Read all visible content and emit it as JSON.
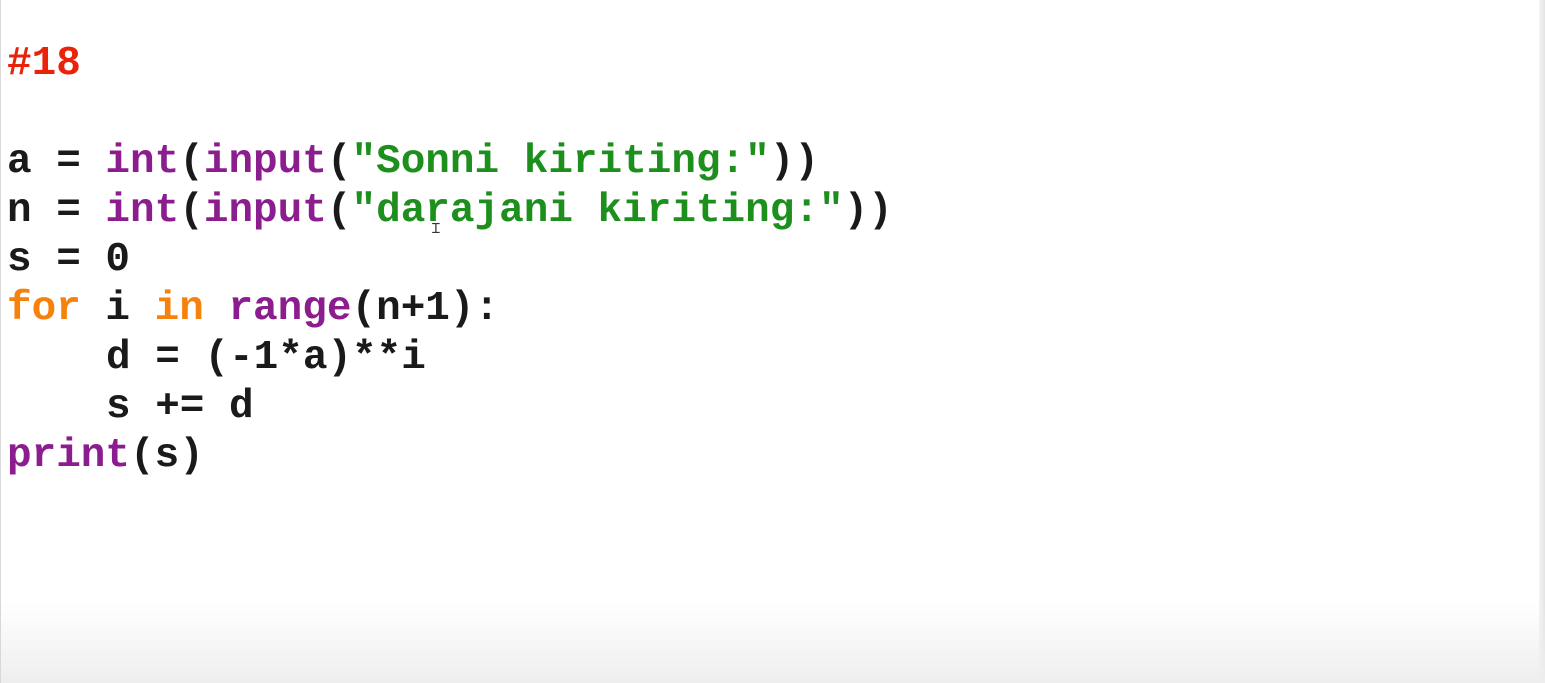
{
  "colors": {
    "comment": "#e8230a",
    "builtin": "#8b1d8e",
    "keyword": "#f5820d",
    "string": "#1d8f1d",
    "default": "#1a1a1a"
  },
  "lines": [
    {
      "name": "comment-line",
      "indent": false,
      "tokens": [
        {
          "t": "#18",
          "c": "comment"
        }
      ]
    },
    {
      "name": "blank-line",
      "indent": false,
      "tokens": []
    },
    {
      "name": "code-line-a",
      "indent": false,
      "tokens": [
        {
          "t": "a = ",
          "c": "default"
        },
        {
          "t": "int",
          "c": "builtin"
        },
        {
          "t": "(",
          "c": "default"
        },
        {
          "t": "input",
          "c": "builtin"
        },
        {
          "t": "(",
          "c": "default"
        },
        {
          "t": "\"Sonni kiriting:\"",
          "c": "string"
        },
        {
          "t": "))",
          "c": "default"
        }
      ]
    },
    {
      "name": "code-line-n",
      "indent": false,
      "tokens": [
        {
          "t": "n = ",
          "c": "default"
        },
        {
          "t": "int",
          "c": "builtin"
        },
        {
          "t": "(",
          "c": "default"
        },
        {
          "t": "input",
          "c": "builtin"
        },
        {
          "t": "(",
          "c": "default"
        },
        {
          "t": "\"darajani kiriting:\"",
          "c": "string"
        },
        {
          "t": "))",
          "c": "default"
        }
      ]
    },
    {
      "name": "code-line-s",
      "indent": false,
      "tokens": [
        {
          "t": "s = 0",
          "c": "default"
        }
      ]
    },
    {
      "name": "code-line-for",
      "indent": false,
      "tokens": [
        {
          "t": "for",
          "c": "keyword"
        },
        {
          "t": " i ",
          "c": "default"
        },
        {
          "t": "in",
          "c": "keyword"
        },
        {
          "t": " ",
          "c": "default"
        },
        {
          "t": "range",
          "c": "builtin"
        },
        {
          "t": "(n+1):",
          "c": "default"
        }
      ]
    },
    {
      "name": "code-line-d",
      "indent": true,
      "tokens": [
        {
          "t": "d = (-1*a)**i",
          "c": "default"
        }
      ]
    },
    {
      "name": "code-line-sum",
      "indent": true,
      "tokens": [
        {
          "t": "s += d",
          "c": "default"
        }
      ]
    },
    {
      "name": "code-line-print",
      "indent": false,
      "tokens": [
        {
          "t": "print",
          "c": "builtin"
        },
        {
          "t": "(s)",
          "c": "default"
        }
      ]
    }
  ],
  "cursor_glyph": "Ɪ"
}
